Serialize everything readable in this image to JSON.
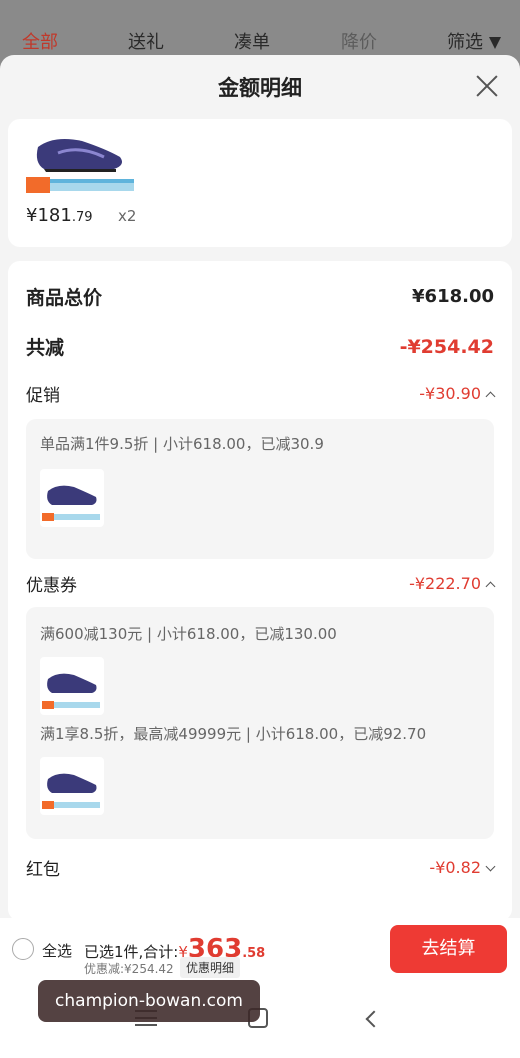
{
  "tabs": [
    {
      "label": "全部",
      "active": true
    },
    {
      "label": "送礼"
    },
    {
      "label": "凑单"
    },
    {
      "label": "降价"
    },
    {
      "label": "筛选"
    }
  ],
  "sheet": {
    "title": "金额明细"
  },
  "product": {
    "price_main": "¥181",
    "price_cents": ".79",
    "quantity": "x2"
  },
  "summary": {
    "total_label": "商品总价",
    "total_value": "¥618.00",
    "reduce_label": "共减",
    "reduce_value": "-¥254.42",
    "promo_label": "促销",
    "promo_value": "-¥30.90",
    "promo_detail": "单品满1件9.5折 | 小计618.00，已减30.9",
    "coupon_label": "优惠券",
    "coupon_value": "-¥222.70",
    "coupon_detail_1": "满600减130元 | 小计618.00，已减130.00",
    "coupon_detail_2": "满1享8.5折，最高减49999元 | 小计618.00，已减92.70",
    "redpacket_label": "红包",
    "redpacket_value": "-¥0.82"
  },
  "bottom": {
    "select_all": "全选",
    "selected": "已选1件,合计:",
    "total_symbol": "¥",
    "total_int": "363",
    "total_dec": ".58",
    "discount": "优惠减:¥254.42",
    "discount_button": "优惠明细",
    "checkout": "去结算"
  },
  "overlay": {
    "text": "champion-bowan.com"
  },
  "colors": {
    "accent": "#e03c31",
    "checkout": "#ee3a34",
    "shoe": "#3b3a7a"
  }
}
